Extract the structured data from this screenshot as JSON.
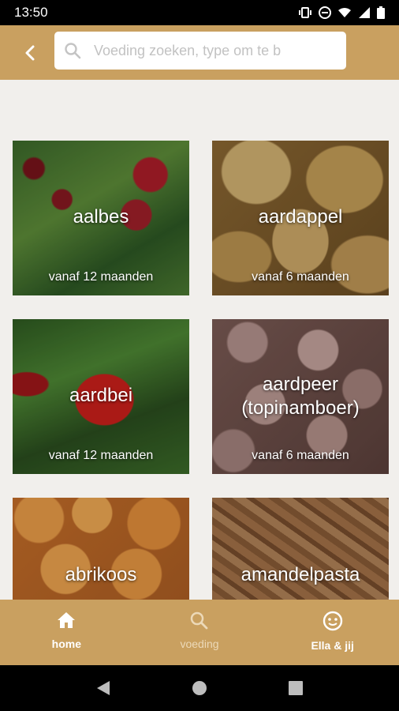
{
  "status_bar": {
    "time": "13:50"
  },
  "search": {
    "placeholder": "Voeding zoeken, type om te b"
  },
  "tiles": [
    {
      "title": "aalbes",
      "subtitle": "vanaf 12 maanden"
    },
    {
      "title": "aardappel",
      "subtitle": "vanaf 6 maanden"
    },
    {
      "title": "aardbei",
      "subtitle": "vanaf 12 maanden"
    },
    {
      "title": "aardpeer (topinamboer)",
      "subtitle": "vanaf 6 maanden"
    },
    {
      "title": "abrikoos",
      "subtitle": ""
    },
    {
      "title": "amandelpasta",
      "subtitle": ""
    }
  ],
  "bottom_nav": [
    {
      "label": "home",
      "icon": "home-icon",
      "active": true
    },
    {
      "label": "voeding",
      "icon": "search-icon",
      "active": false
    },
    {
      "label": "Ella & jij",
      "icon": "face-icon",
      "active": false
    }
  ],
  "colors": {
    "accent": "#c9a060",
    "background": "#f1efec"
  }
}
